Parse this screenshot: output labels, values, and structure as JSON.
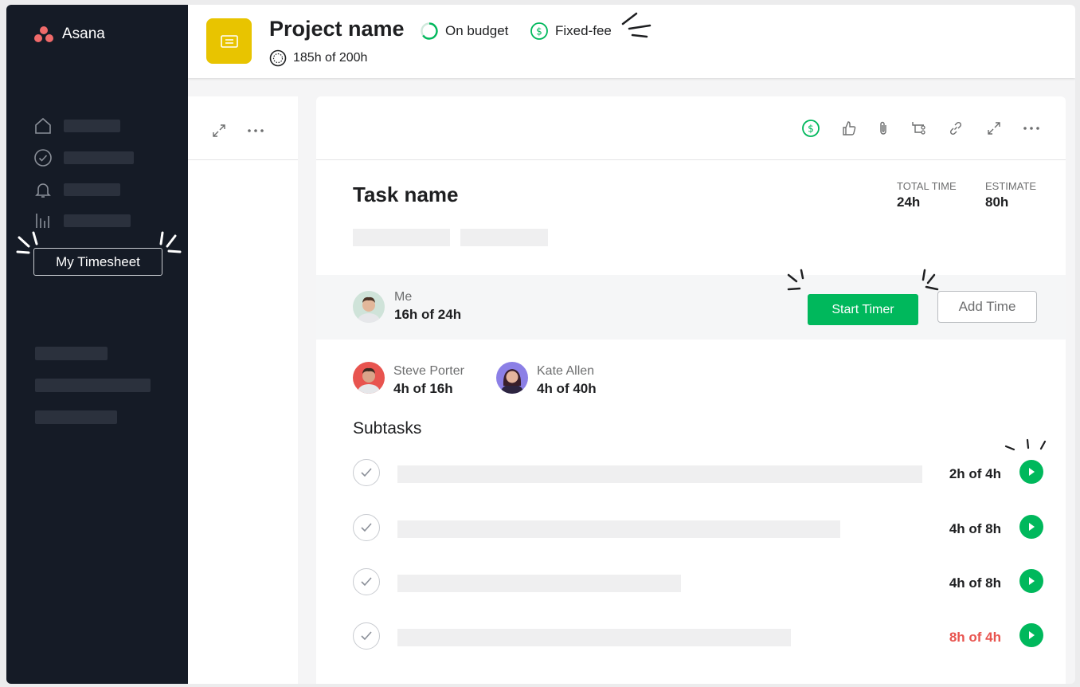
{
  "app": {
    "name": "Asana"
  },
  "sidebar": {
    "nav_icons": [
      "home-icon",
      "check-circle-icon",
      "bell-icon",
      "reporting-icon"
    ],
    "timesheet_label": "My Timesheet"
  },
  "header": {
    "project_name": "Project name",
    "status": "On budget",
    "billing": "Fixed-fee",
    "hours": "185h of 200h"
  },
  "task": {
    "title": "Task name",
    "total_time_label": "TOTAL TIME",
    "total_time": "24h",
    "estimate_label": "ESTIMATE",
    "estimate": "80h",
    "me": {
      "name": "Me",
      "hours": "16h of 24h"
    },
    "start_timer": "Start Timer",
    "add_time": "Add Time",
    "collaborators": [
      {
        "name": "Steve Porter",
        "hours": "4h of 16h"
      },
      {
        "name": "Kate Allen",
        "hours": "4h of 40h"
      }
    ]
  },
  "subtasks": {
    "title": "Subtasks",
    "items": [
      {
        "hours": "2h of 4h",
        "over": false
      },
      {
        "hours": "4h of 8h",
        "over": false
      },
      {
        "hours": "4h of 8h",
        "over": false
      },
      {
        "hours": "8h of 4h",
        "over": true
      }
    ]
  },
  "colors": {
    "accent_green": "#00b85c",
    "sidebar_bg": "#151b26",
    "project_yellow": "#e8c400",
    "over_red": "#e8544f"
  }
}
